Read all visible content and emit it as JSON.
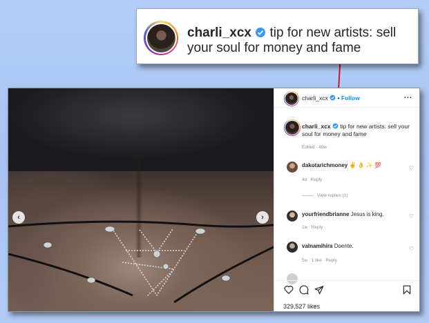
{
  "callout": {
    "username": "charli_xcx",
    "caption": "tip for new artists: sell your soul for money and fame"
  },
  "post": {
    "header": {
      "username": "charli_xcx",
      "follow_label": "Follow",
      "more_label": "..."
    },
    "caption": {
      "username": "charli_xcx",
      "text": "tip for new artists: sell your soul for money and fame",
      "meta": "Edited · 40w"
    },
    "comments": [
      {
        "username": "dakotarichmoney",
        "text": "✌️ 👌 ✨ 💯",
        "meta_time": "4d",
        "reply_label": "Reply",
        "likes": ""
      },
      {
        "username": "yourfriendbrianne",
        "text": "Jesus is king.",
        "meta_time": "1w",
        "reply_label": "Reply",
        "likes": ""
      },
      {
        "username": "valnamihira",
        "text": "Doente.",
        "meta_time": "5w",
        "reply_label": "Reply",
        "likes": "1 like"
      }
    ],
    "view_replies": "View replies (1)",
    "likes": "329,527 likes",
    "nav": {
      "prev": "‹",
      "next": "›"
    }
  },
  "colors": {
    "background": "#aec7f5",
    "follow": "#0095f6",
    "verified": "#3897f0",
    "arrow": "#cc1122"
  },
  "icons": [
    "verified-badge-icon",
    "heart-icon",
    "comment-icon",
    "share-icon",
    "bookmark-icon",
    "more-icon"
  ]
}
